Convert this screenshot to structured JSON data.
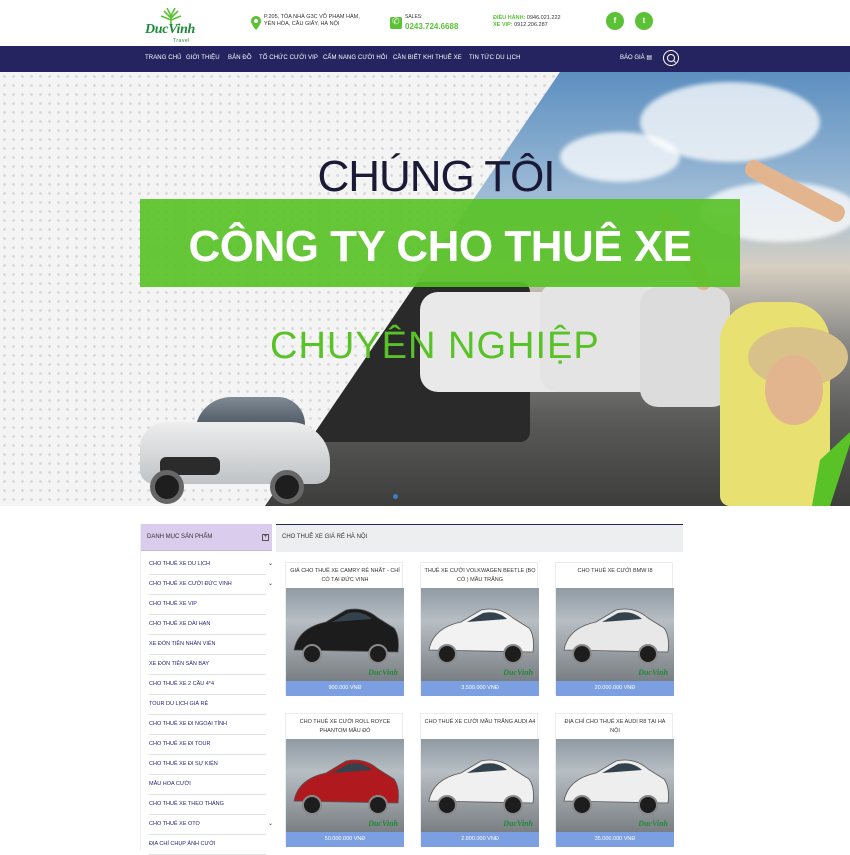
{
  "header": {
    "logo_text": "DucVinh",
    "logo_sub": "Travel",
    "address_line1": "P.205, TÒA NHÀ G3C VÕ PHẠM HÀM,",
    "address_line2": "YÊN HÒA, CẦU GIẤY, HÀ NỘI",
    "sales_label": "SALES:",
    "sales_number": "0243.724.6688",
    "dispatch_label": "ĐIỀU HÀNH:",
    "dispatch_number": "0946.021.222",
    "vip_label": "XE VIP:",
    "vip_number": "0912.206.287",
    "social": {
      "facebook": "f",
      "twitter": "t"
    }
  },
  "nav": {
    "items": [
      "TRANG CHỦ",
      "GIỚI THIỆU",
      "BẢN ĐỒ",
      "TỔ CHỨC CƯỚI VIP",
      "CẨM NANG CƯỚI HỎI",
      "CẦN BIẾT KHI THUÊ XE",
      "TIN TỨC DU LỊCH"
    ],
    "quote": "BÁO GIÁ ▤"
  },
  "hero": {
    "line1": "CHÚNG TÔI",
    "line2": "CÔNG TY CHO THUÊ XE",
    "line3": "CHUYÊN NGHIỆP"
  },
  "sidebar": {
    "title": "DANH MỤC SẢN PHẨM",
    "toggle": "+",
    "items": [
      {
        "label": "CHO THUÊ XE DU LỊCH",
        "chevron": true
      },
      {
        "label": "CHO THUÊ XE CƯỚI ĐỨC VINH",
        "chevron": true
      },
      {
        "label": "CHO THUÊ XE VIP",
        "chevron": false
      },
      {
        "label": "CHO THUÊ XE DÀI HẠN",
        "chevron": false
      },
      {
        "label": "XE ĐÓN TIỄN NHÂN VIÊN",
        "chevron": false
      },
      {
        "label": "XE ĐÓN TIỄN SÂN BAY",
        "chevron": false
      },
      {
        "label": "CHO THUÊ XE 2 CẦU 4*4",
        "chevron": false
      },
      {
        "label": "TOUR DU LỊCH GIÁ RẺ",
        "chevron": false
      },
      {
        "label": "CHO THUÊ XE ĐI NGOẠI TỈNH",
        "chevron": false
      },
      {
        "label": "CHO THUÊ XE ĐI TOUR",
        "chevron": false
      },
      {
        "label": "CHO THUÊ XE ĐI SỰ KIỆN",
        "chevron": false
      },
      {
        "label": "MẪU HOA CƯỚI",
        "chevron": false
      },
      {
        "label": "CHO THUÊ XE THEO THÁNG",
        "chevron": false
      },
      {
        "label": "CHO THUÊ XE OTO",
        "chevron": true
      },
      {
        "label": "ĐỊA CHỈ CHỤP ẢNH CƯỚI",
        "chevron": false
      }
    ]
  },
  "main": {
    "title": "CHO THUÊ XE GIÁ RẺ HÀ NỘI",
    "products": [
      {
        "title": "GIÁ CHO THUÊ XE CAMRY RẺ NHẤT - CHỈ CÓ TẠI ĐỨC VINH",
        "price": "900.000 VNĐ",
        "color": "#1c1c1c"
      },
      {
        "title": "THUÊ XE CƯỚI VOLKWAGEN BEETLE (BỌ CÒ ) MẦU TRẮNG",
        "price": "3.500.000 VNĐ",
        "color": "#f2f2f2"
      },
      {
        "title": "CHO THUÊ XE CƯỚI BMW I8",
        "price": "20.000.000 VNĐ",
        "color": "#e8e8e8"
      },
      {
        "title": "CHO THUÊ XE CƯỚI ROLL ROYCE PHANTOM MẦU ĐỎ",
        "price": "50.000.000 VNĐ",
        "color": "#b01a1f"
      },
      {
        "title": "CHO THUÊ XE CƯỚI MẦU TRẮNG AUDI A4",
        "price": "2.800.000 VNĐ",
        "color": "#f0f0f0"
      },
      {
        "title": "ĐỊA CHỈ CHO THUÊ XE AUDI R8 TẠI HÀ NỘI",
        "price": "35.000.000 VNĐ",
        "color": "#eeeeee"
      }
    ],
    "watermark": "DucVinh"
  }
}
